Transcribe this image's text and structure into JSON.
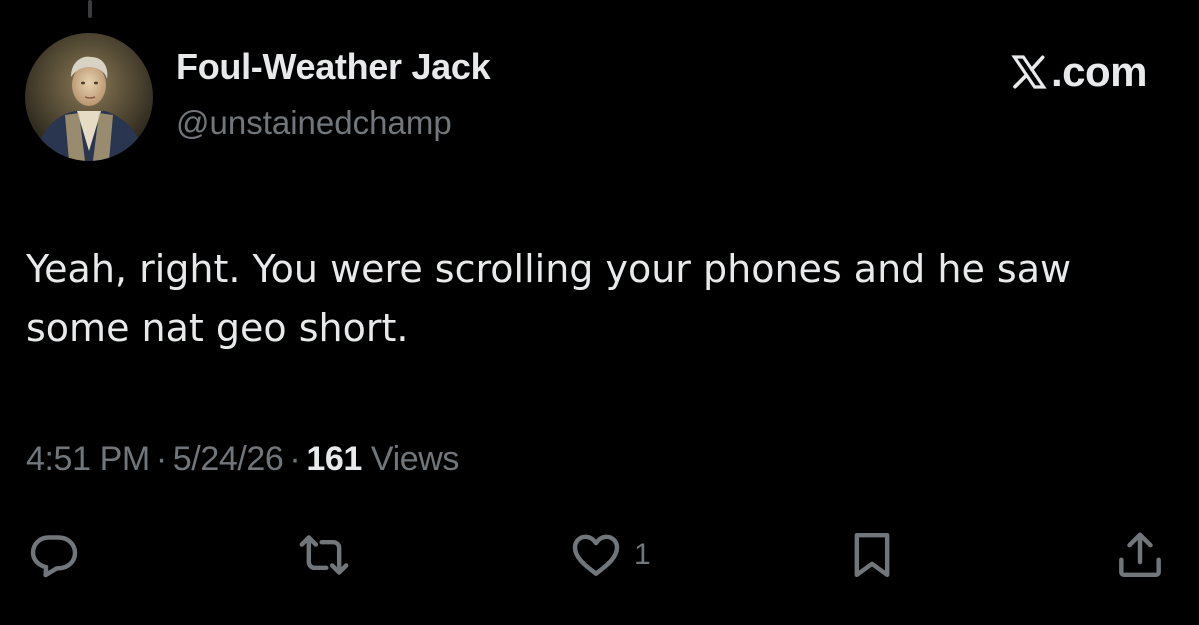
{
  "author": {
    "display_name": "Foul-Weather Jack",
    "handle": "@unstainedchamp",
    "avatar": "portrait-avatar"
  },
  "brand": {
    "icon": "x-logo-icon",
    "domain": ".com"
  },
  "tweet": {
    "text": "Yeah, right. You were scrolling your phones and he saw some nat geo short."
  },
  "meta": {
    "time": "4:51 PM",
    "separator": "·",
    "date": "5/24/26",
    "views_count": "161",
    "views_label": "Views"
  },
  "actions": {
    "reply_icon": "reply-icon",
    "repost_icon": "repost-icon",
    "like_icon": "heart-icon",
    "like_count": "1",
    "bookmark_icon": "bookmark-icon",
    "share_icon": "share-icon"
  },
  "colors": {
    "background": "#000000",
    "primary_text": "#e7e9ea",
    "secondary_text": "#71767b"
  }
}
